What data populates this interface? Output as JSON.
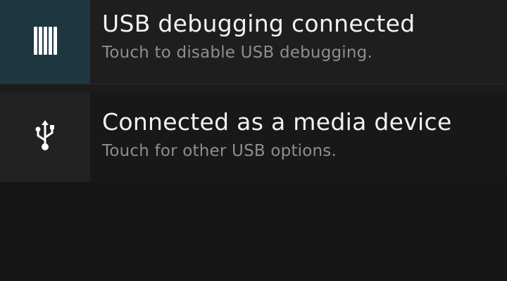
{
  "notifications": [
    {
      "icon": "android-debug-icon",
      "title": "USB debugging connected",
      "subtitle": "Touch to disable USB debugging."
    },
    {
      "icon": "usb-icon",
      "title": "Connected as a media device",
      "subtitle": "Touch for other USB options."
    }
  ],
  "colors": {
    "background": "#161616",
    "icon_bg_debug": "#1d3640",
    "title_text": "#f2f2f2",
    "subtitle_text": "#8e8e8e"
  }
}
